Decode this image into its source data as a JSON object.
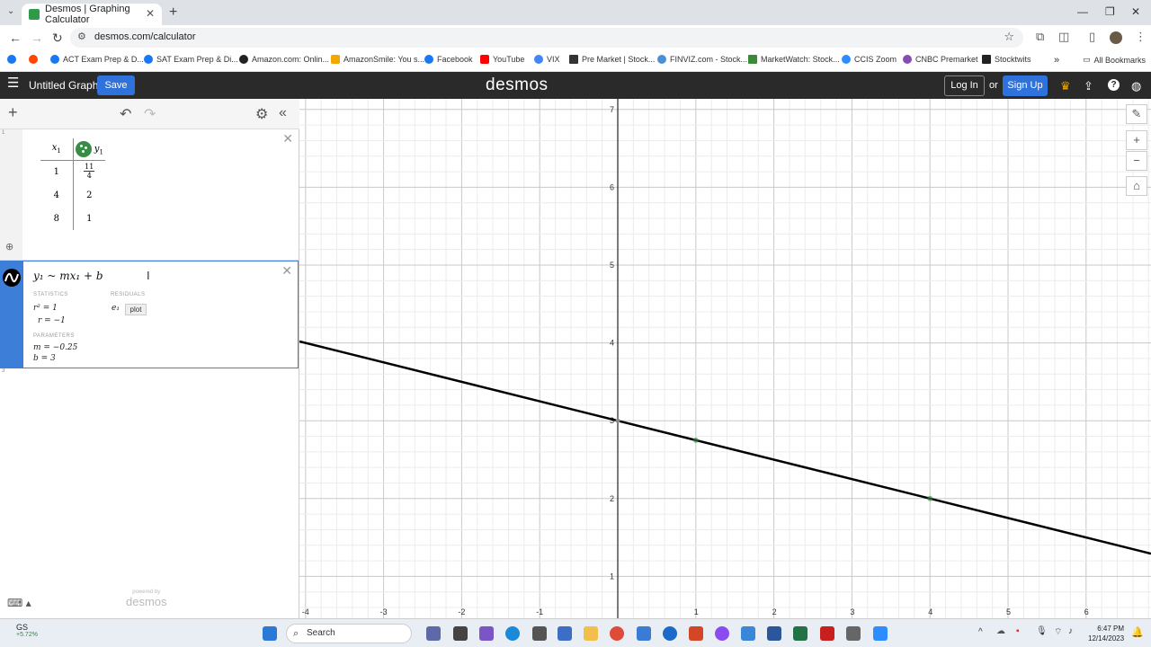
{
  "browser": {
    "tab_title": "Desmos | Graphing Calculator",
    "url": "desmos.com/calculator",
    "bookmarks": [
      "ACT Exam Prep & D...",
      "SAT Exam Prep & Di...",
      "Amazon.com: Onlin...",
      "AmazonSmile: You s...",
      "Facebook",
      "YouTube",
      "VIX",
      "Pre Market | Stock...",
      "FINVIZ.com - Stock...",
      "MarketWatch: Stock...",
      "CCIS Zoom",
      "CNBC Premarket",
      "Stocktwits"
    ],
    "all_bookmarks": "All Bookmarks"
  },
  "header": {
    "graph_title": "Untitled Graph",
    "save_label": "Save",
    "logo": "desmos",
    "login_label": "Log In",
    "or_text": "or",
    "signup_label": "Sign Up"
  },
  "expressions": {
    "table": {
      "col_x": "x",
      "col_x_sub": "1",
      "col_y": "y",
      "col_y_sub": "1",
      "rows": [
        {
          "x": "1",
          "y_num": "11",
          "y_den": "4"
        },
        {
          "x": "4",
          "y": "2"
        },
        {
          "x": "8",
          "y": "1"
        }
      ]
    },
    "regression": {
      "formula": "y₁ ~ mx₁ + b",
      "statistics_label": "STATISTICS",
      "residuals_label": "RESIDUALS",
      "r2": "r² = 1",
      "r": "r = −1",
      "residual_var": "e₁",
      "plot_label": "plot",
      "parameters_label": "PARAMETERS",
      "m": "m = −0.25",
      "b": "b = 3"
    },
    "powered_by": "powered by",
    "powered_logo": "desmos"
  },
  "graph": {
    "x_ticks": [
      "-4",
      "-3",
      "-2",
      "-1",
      "1",
      "2",
      "3",
      "4",
      "5",
      "6"
    ],
    "y_ticks": [
      "1",
      "2",
      "3",
      "4",
      "5",
      "6",
      "7"
    ],
    "line": {
      "m": -0.25,
      "b": 3
    },
    "points": [
      {
        "x": 1,
        "y": 2.75
      },
      {
        "x": 4,
        "y": 2
      },
      {
        "x": 8,
        "y": 1
      }
    ]
  },
  "taskbar": {
    "ticker": "GS",
    "change": "+5.72%",
    "search_placeholder": "Search",
    "time": "6:47 PM",
    "date": "12/14/2023"
  }
}
